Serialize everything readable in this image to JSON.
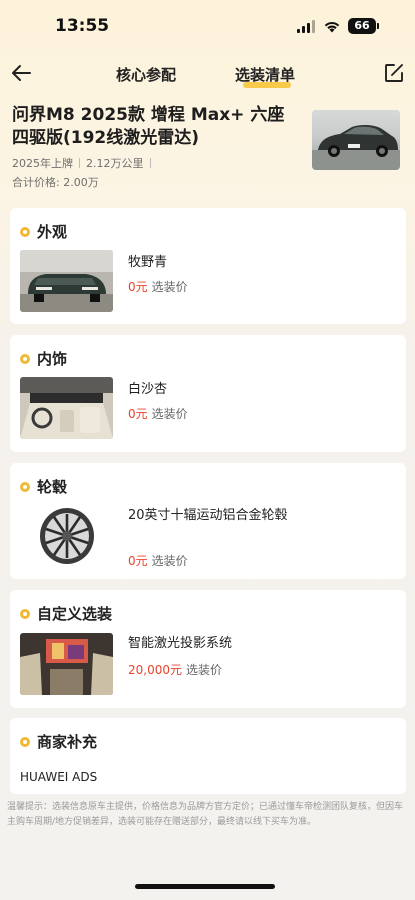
{
  "status": {
    "time": "13:55",
    "battery": "66"
  },
  "nav": {
    "tabs": [
      {
        "label": "核心参配"
      },
      {
        "label": "选装清单"
      }
    ],
    "active_tab": "选装清单"
  },
  "car": {
    "title": "问界M8 2025款 增程 Max+ 六座四驱版(192线激光雷达)",
    "registered": "2025年上牌",
    "mileage": "2.12万公里",
    "total": "合计价格: 2.00万"
  },
  "sections": {
    "exterior": {
      "title": "外观",
      "item": "牧野青",
      "price": "0元",
      "price_tag": "选装价"
    },
    "interior": {
      "title": "内饰",
      "item": "白沙杏",
      "price": "0元",
      "price_tag": "选装价"
    },
    "wheels": {
      "title": "轮毂",
      "item": "20英寸十辐运动铝合金轮毂",
      "price": "0元",
      "price_tag": "选装价"
    },
    "custom": {
      "title": "自定义选装",
      "item": "智能激光投影系统",
      "price": "20,000元",
      "price_tag": "选装价"
    },
    "merchant": {
      "title": "商家补充",
      "text": "HUAWEI ADS"
    }
  },
  "disclaimer": "温馨提示：选装信息原车主提供，价格信息为品牌方官方定价；已通过懂车帝检测团队复核，但因车主购车周期/地方促销差异，选装可能存在赠送部分，最终请以线下买车为准。",
  "colors": {
    "accent": "#f0b935",
    "price": "#e8442c"
  }
}
